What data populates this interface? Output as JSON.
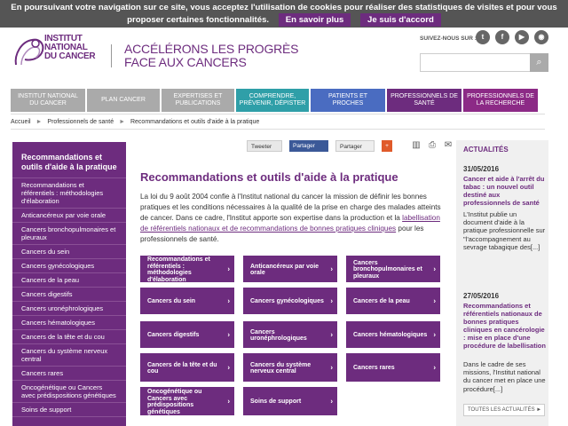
{
  "cookie": {
    "line1": "En poursuivant votre navigation sur ce site, vous acceptez l'utilisation de cookies pour réaliser des statistiques de visites et pour vous",
    "line2": "proposer certaines fonctionnalités.",
    "more_label": "En savoir plus",
    "accept_label": "Je suis d'accord"
  },
  "header": {
    "logo_line1": "INSTITUT",
    "logo_line2": "NATIONAL",
    "logo_line3": "DU CANCER",
    "tagline1": "ACCÉLÉRONS LES PROGRÈS",
    "tagline2": "FACE AUX CANCERS",
    "follow_label": "SUIVEZ-NOUS SUR :",
    "social": [
      {
        "icon": "twitter-icon",
        "glyph": "t"
      },
      {
        "icon": "facebook-icon",
        "glyph": "f"
      },
      {
        "icon": "youtube-icon",
        "glyph": "▶"
      },
      {
        "icon": "rss-icon",
        "glyph": "◉"
      }
    ],
    "search_placeholder": ""
  },
  "nav": [
    {
      "label": "INSTITUT NATIONAL DU CANCER",
      "color": "#aaaaaa"
    },
    {
      "label": "PLAN CANCER",
      "color": "#aaaaaa"
    },
    {
      "label": "EXPERTISES ET PUBLICATIONS",
      "color": "#aaaaaa"
    },
    {
      "label": "COMPRENDRE, PRÉVENIR, DÉPISTER",
      "color": "#2f9fa8"
    },
    {
      "label": "PATIENTS ET PROCHES",
      "color": "#4a6cc1"
    },
    {
      "label": "PROFESSIONNELS DE SANTÉ",
      "color": "#6d2c7e"
    },
    {
      "label": "PROFESSIONNELS DE LA RECHERCHE",
      "color": "#8c2a86"
    }
  ],
  "breadcrumb": {
    "home": "Accueil",
    "level1": "Professionnels de santé",
    "current": "Recommandations et outils d'aide à la pratique",
    "separator": "►"
  },
  "sidebar": {
    "title": "Recommandations et outils d'aide à la pratique",
    "items": [
      "Recommandations et référentiels : méthodologies d'élaboration",
      "Anticancéreux par voie orale",
      "Cancers bronchopulmonaires et pleuraux",
      "Cancers du sein",
      "Cancers gynécologiques",
      "Cancers de la peau",
      "Cancers digestifs",
      "Cancers uronéphrologiques",
      "Cancers hématologiques",
      "Cancers de la tête et du cou",
      "Cancers du système nerveux central",
      "Cancers rares",
      "Oncogénétique ou Cancers avec prédispositions génétiques",
      "Soins de support"
    ]
  },
  "share": {
    "tweet": "Tweeter",
    "facebook": "Partager",
    "gplus": "Partager",
    "plus": "+"
  },
  "main": {
    "title": "Recommandations et outils d'aide à la pratique",
    "intro_before": "La loi du 9 août 2004 confie à l'Institut national du cancer la mission de définir les bonnes pratiques et les conditions nécessaires à la qualité de la prise en charge des malades atteints de cancer. Dans ce cadre, l'Institut apporte son expertise dans la production et la ",
    "intro_link": "labellisation de référentiels nationaux et de recommandations de bonnes pratiques cliniques",
    "intro_after": " pour les professionnels de santé.",
    "tiles": [
      "Recommandations et référentiels : méthodologies d'élaboration",
      "Anticancéreux par voie orale",
      "Cancers bronchopulmonaires et pleuraux",
      "Cancers du sein",
      "Cancers gynécologiques",
      "Cancers de la peau",
      "Cancers digestifs",
      "Cancers uronéphrologiques",
      "Cancers hématologiques",
      "Cancers de la tête et du cou",
      "Cancers du système nerveux central",
      "Cancers rares",
      "Oncogénétique ou Cancers avec prédispositions génétiques",
      "Soins de support"
    ]
  },
  "actualites": {
    "heading": "ACTUALITÉS",
    "items": [
      {
        "date": "31/05/2016",
        "title": "Cancer et aide à l'arrêt du tabac : un nouvel outil destiné aux professionnels de santé",
        "body": "L'Institut publie un document d'aide à la pratique professionnelle sur \"l'accompagnement au sevrage tabagique des[...]"
      },
      {
        "date": "27/05/2016",
        "title": "Recommandations et référentiels nationaux de bonnes pratiques cliniques en cancérologie : mise en place d'une procédure de labellisation",
        "body": "Dans le cadre de ses missions, l'Institut national du cancer met en place une procédure[...]"
      }
    ],
    "all_label": "TOUTES LES ACTUALITÉS ►"
  }
}
